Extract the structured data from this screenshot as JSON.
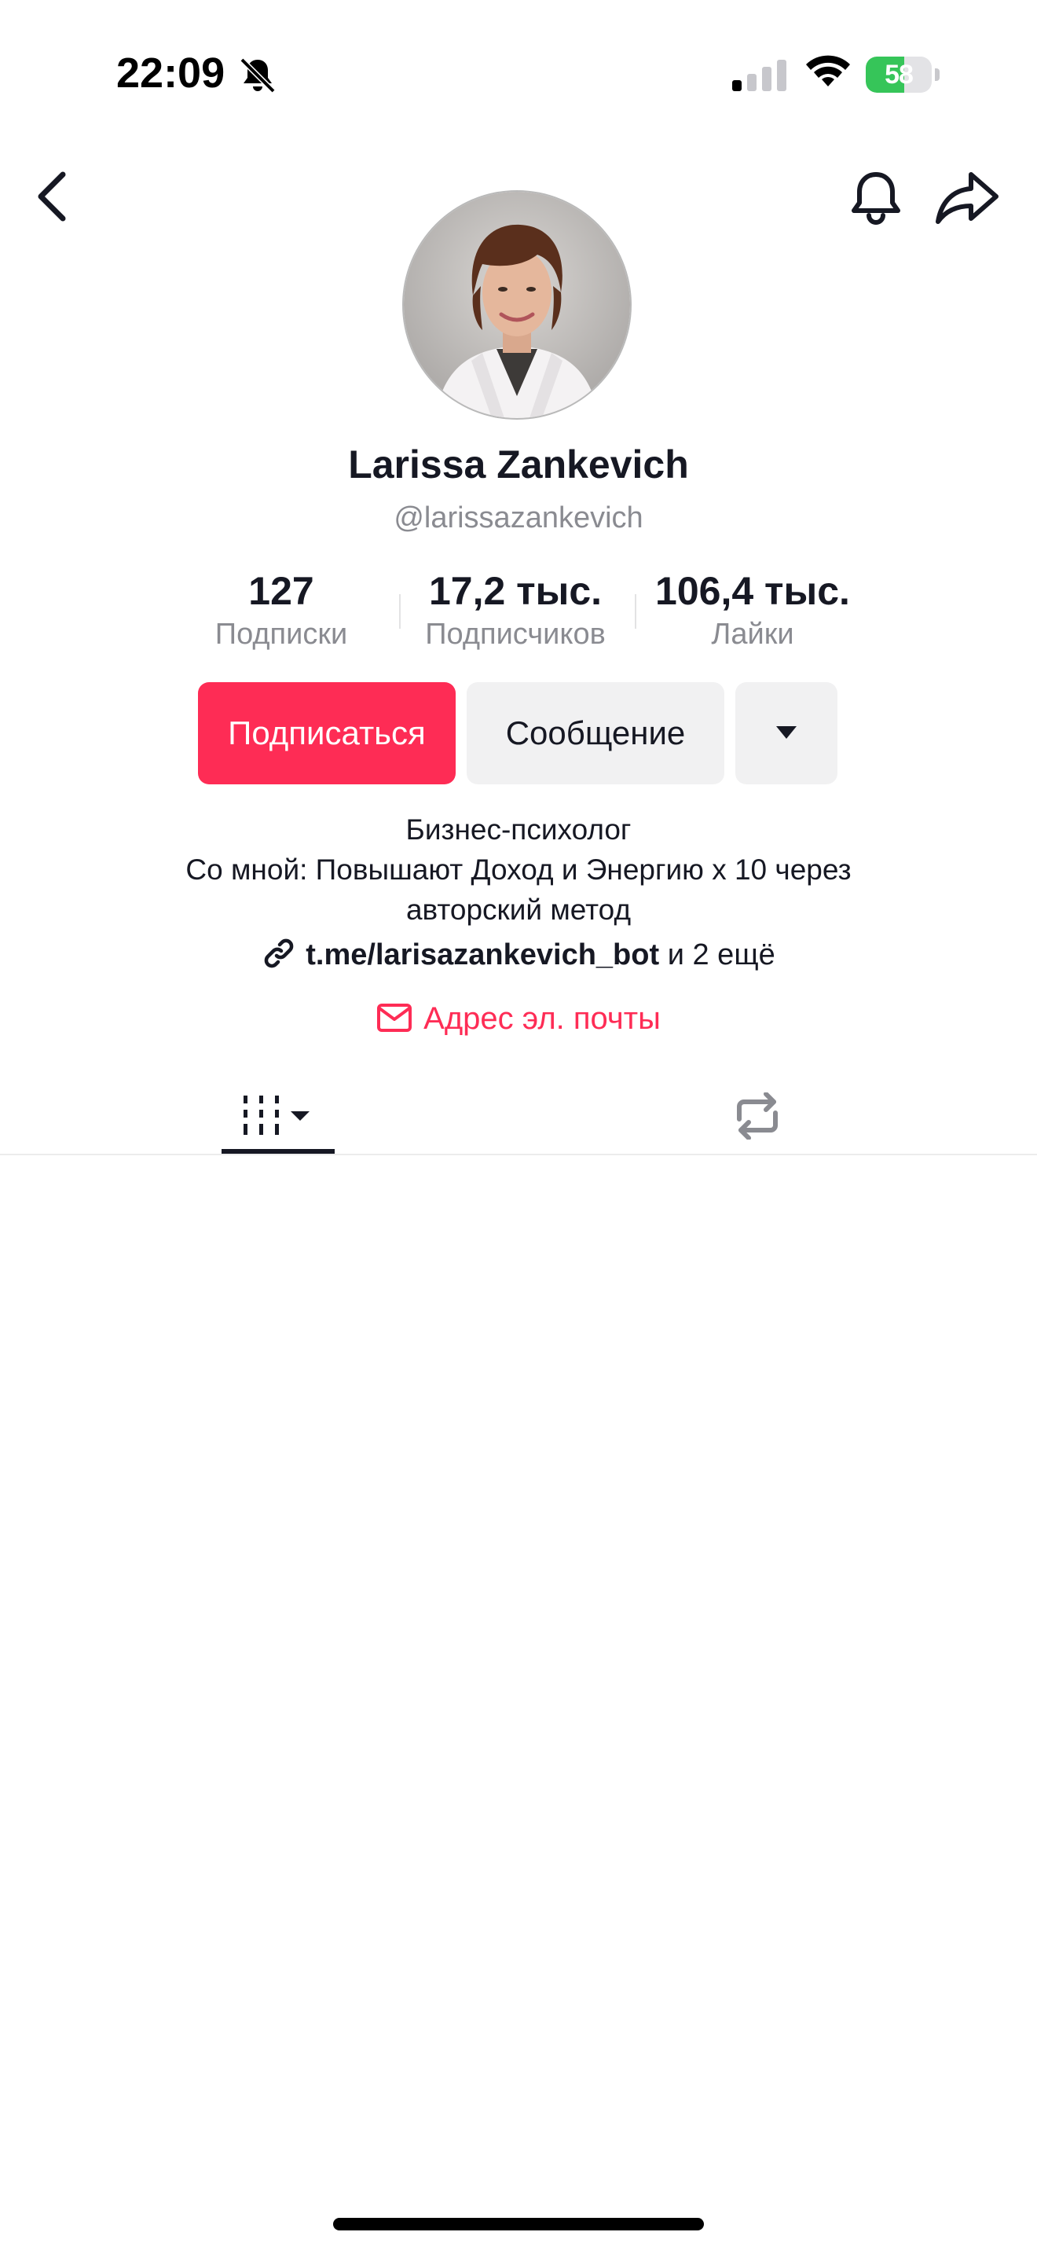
{
  "status_bar": {
    "time": "22:09",
    "battery_level": "58",
    "battery_fraction": 0.58,
    "icons": [
      "bell-slash-icon",
      "cellular-signal-icon",
      "wifi-icon",
      "battery-charging-icon"
    ]
  },
  "nav": {
    "back_icon": "chevron-left-icon",
    "notifications_icon": "bell-icon",
    "share_icon": "share-arrow-icon"
  },
  "profile": {
    "name": "Larissa Zankevich",
    "handle": "@larissazankevich"
  },
  "stats": [
    {
      "value": "127",
      "label": "Подписки"
    },
    {
      "value": "17,2 тыс.",
      "label": "Подписчиков"
    },
    {
      "value": "106,4 тыс.",
      "label": "Лайки"
    }
  ],
  "actions": {
    "follow_label": "Подписаться",
    "message_label": "Сообщение",
    "more_icon": "caret-down-icon"
  },
  "bio": {
    "line1": "Бизнес-психолог",
    "line2": "Со мной: Повышают Доход и Энергию х 10 через",
    "line3": "авторский метод",
    "link_url": "t.me/larisazankevich_bot",
    "link_more": "и 2 ещё",
    "email_label": "Адрес эл. почты"
  },
  "tabs": {
    "videos_icon": "grid-videos-icon",
    "reposts_icon": "repost-icon",
    "active": "videos"
  },
  "colors": {
    "accent": "#fe2c55",
    "text_primary": "#161823",
    "text_secondary": "#8a8b91",
    "button_secondary_bg": "#f1f1f2",
    "battery_green": "#36c559"
  }
}
